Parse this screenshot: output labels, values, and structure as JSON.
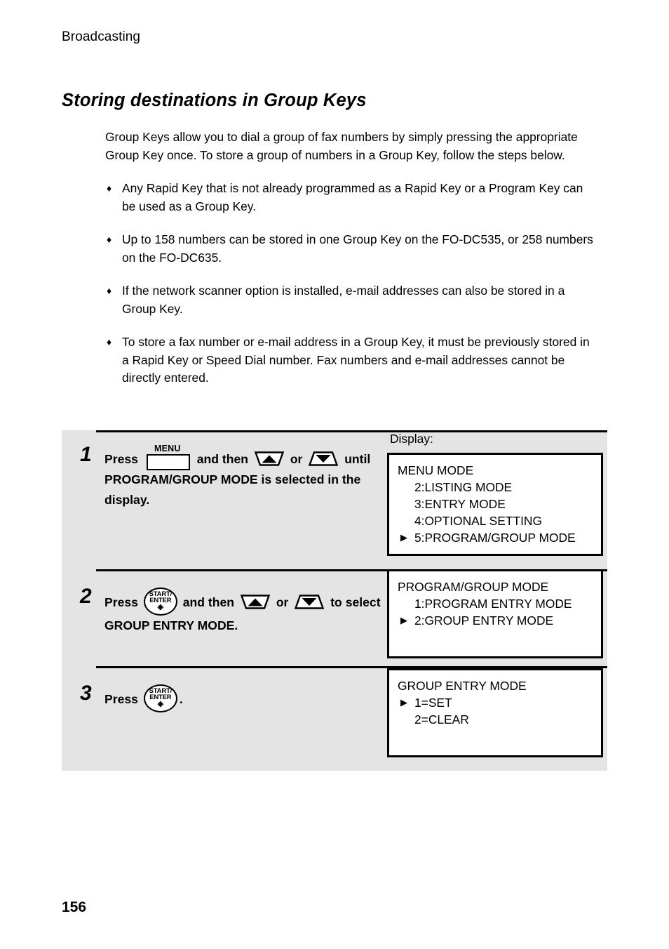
{
  "page": {
    "running_head": "Broadcasting",
    "folio": "156",
    "background": "#ffffff",
    "panel_color": "#e4e4e4"
  },
  "section": {
    "title": "Storing destinations in Group Keys",
    "intro": "Group Keys allow you to dial a group of fax numbers by simply pressing the appropriate Group Key once. To store a group of numbers in a Group Key, follow the steps below.",
    "bullet_marker": "♦",
    "bullets": [
      "Any Rapid Key that is not already programmed as a Rapid Key or a Program Key can be used as a Group Key.",
      "Up to 158 numbers can be stored in one Group Key on the FO-DC535, or 258 numbers on the FO-DC635.",
      "If the network scanner option is installed, e-mail addresses can also be stored in a Group Key.",
      "To store a fax number or e-mail address in a Group Key, it must be previously stored in a Rapid Key or Speed Dial number. Fax numbers and e-mail addresses cannot be directly entered."
    ]
  },
  "procedure": {
    "display_label": "Display:",
    "keys": {
      "menu": {
        "label": "MENU",
        "name": "menu-key"
      },
      "start_enter": {
        "line1": "START/",
        "line2": "ENTER",
        "glyph": "◈",
        "name": "start-enter-key"
      },
      "up": {
        "name": "up-arrow-key"
      },
      "down": {
        "name": "down-arrow-key"
      }
    },
    "steps": [
      {
        "number": "1",
        "text_parts": {
          "press": "Press",
          "and_then": "and then",
          "or": "or",
          "tail": "until PROGRAM/GROUP MODE is selected in the display."
        },
        "lcd": {
          "lines": [
            {
              "text": "MENU MODE",
              "style": "plain"
            },
            {
              "text": "2:LISTING MODE",
              "style": "indent"
            },
            {
              "text": "3:ENTRY MODE",
              "style": "indent"
            },
            {
              "text": "4:OPTIONAL SETTING",
              "style": "indent"
            },
            {
              "text": "5:PROGRAM/GROUP MODE",
              "style": "selected"
            }
          ]
        }
      },
      {
        "number": "2",
        "text_parts": {
          "press": "Press",
          "and_then": "and then",
          "or": "or",
          "to": "to",
          "tail": "select GROUP ENTRY MODE."
        },
        "lcd": {
          "lines": [
            {
              "text": "PROGRAM/GROUP MODE",
              "style": "plain"
            },
            {
              "text": "1:PROGRAM ENTRY MODE",
              "style": "indent"
            },
            {
              "text": "2:GROUP ENTRY MODE",
              "style": "selected"
            }
          ]
        }
      },
      {
        "number": "3",
        "text_parts": {
          "press": "Press",
          "period": "."
        },
        "lcd": {
          "lines": [
            {
              "text": "GROUP ENTRY MODE",
              "style": "plain"
            },
            {
              "text": "1=SET",
              "style": "selected"
            },
            {
              "text": "2=CLEAR",
              "style": "indent"
            }
          ]
        }
      }
    ],
    "cursor_glyph": "▶"
  }
}
